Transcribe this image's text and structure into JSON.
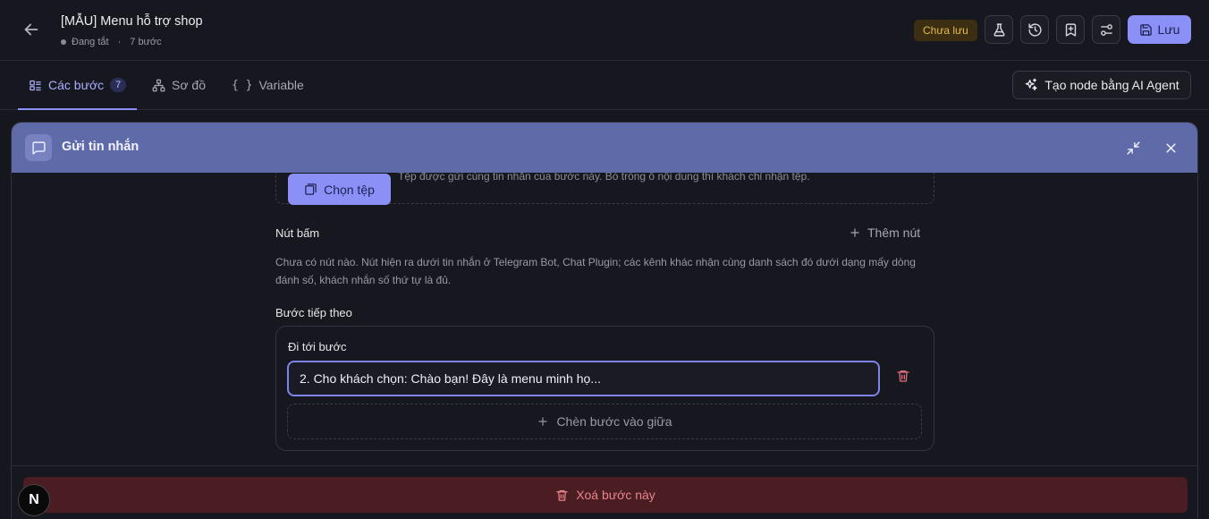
{
  "header": {
    "title": "[MẪU] Menu hỗ trợ shop",
    "status": "Đang tắt",
    "separator": "·",
    "steps_count": "7 bước",
    "unsaved_badge": "Chưa lưu",
    "save_label": "Lưu",
    "icons": [
      "back-arrow-icon",
      "flask-icon",
      "history-icon",
      "bookmark-plus-icon",
      "settings-sliders-icon",
      "save-icon"
    ]
  },
  "tabs": [
    {
      "label": "Các bước",
      "badge": "7",
      "icon": "list-icon",
      "active": true
    },
    {
      "label": "Sơ đồ",
      "icon": "sitemap-icon",
      "active": false
    },
    {
      "label": "Variable",
      "icon": "braces-icon",
      "active": false
    }
  ],
  "ai_agent_button": "Tạo node bằng AI Agent",
  "modal": {
    "title": "Gửi tin nhắn",
    "header_color": "#5f6aa8",
    "file": {
      "button_label": "Chọn tệp",
      "hint": "Tệp được gửi cùng tin nhắn của bước này. Bỏ trống ô nội dung thì khách chỉ nhận tệp."
    },
    "buttons_section": {
      "label": "Nút bấm",
      "add_label": "Thêm nút",
      "help": "Chưa có nút nào. Nút hiện ra dưới tin nhắn ở Telegram Bot, Chat Plugin; các kênh khác nhận cùng danh sách đó dưới dạng mấy dòng đánh số, khách nhắn số thứ tự là đủ."
    },
    "next_step": {
      "label": "Bước tiếp theo",
      "goto_label": "Đi tới bước",
      "selected_value": "2. Cho khách chọn: Chào bạn! Đây là menu minh họ...",
      "insert_label": "Chèn bước vào giữa"
    },
    "delete_label": "Xoá bước này"
  },
  "logo_letter": "N",
  "colors": {
    "accent": "#8a90f5",
    "danger": "#e8848c",
    "warning": "#e7b84a"
  }
}
